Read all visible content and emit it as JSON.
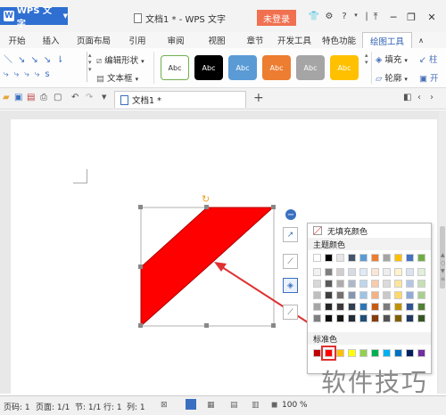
{
  "titlebar": {
    "app_name": "WPS 文字",
    "doc_title": "文档1 * - WPS 文字",
    "login_label": "未登录",
    "icons": [
      "shirt-icon",
      "gear-icon",
      "help-icon",
      "menu-icon",
      "upload-icon"
    ]
  },
  "tabs": [
    "开始",
    "插入",
    "页面布局",
    "引用",
    "审阅",
    "视图",
    "章节",
    "开发工具",
    "特色功能",
    "绘图工具"
  ],
  "active_tab": "绘图工具",
  "ribbon": {
    "edit_shape_label": "编辑形状",
    "textbox_label": "文本框",
    "style_cards": [
      {
        "label": "Abc",
        "bg": "#ffffff",
        "fg": "#333333",
        "border": "#70b050"
      },
      {
        "label": "Abc",
        "bg": "#000000",
        "fg": "#ffffff",
        "border": "#000000"
      },
      {
        "label": "Abc",
        "bg": "#5b9bd5",
        "fg": "#ffffff",
        "border": "#5b9bd5"
      },
      {
        "label": "Abc",
        "bg": "#ed7d31",
        "fg": "#ffffff",
        "border": "#ed7d31"
      },
      {
        "label": "Abc",
        "bg": "#a5a5a5",
        "fg": "#ffffff",
        "border": "#a5a5a5"
      },
      {
        "label": "Abc",
        "bg": "#ffc000",
        "fg": "#ffffff",
        "border": "#ffc000"
      }
    ],
    "fill_label": "填充",
    "outline_label": "轮廓"
  },
  "quickaccess": {
    "doc_tab_label": "文档1 *",
    "new_tab_label": "+"
  },
  "popup": {
    "no_fill_label": "无填充颜色",
    "theme_colors_label": "主题颜色",
    "standard_colors_label": "标准色",
    "theme_top_row": [
      "#ffffff",
      "#000000",
      "#e7e6e6",
      "#44546a",
      "#5b9bd5",
      "#ed7d31",
      "#a5a5a5",
      "#ffc000",
      "#4472c4",
      "#70ad47"
    ],
    "theme_shades": [
      [
        "#f2f2f2",
        "#7f7f7f",
        "#d0cece",
        "#d6dce4",
        "#deebf6",
        "#fbe5d5",
        "#ededed",
        "#fff2cc",
        "#dae3f3",
        "#e2efd9"
      ],
      [
        "#d8d8d8",
        "#595959",
        "#aeabab",
        "#adb9ca",
        "#bdd7ee",
        "#f7cbac",
        "#dbdbdb",
        "#fee599",
        "#b4c6e7",
        "#c5e0b3"
      ],
      [
        "#bfbfbf",
        "#3f3f3f",
        "#757070",
        "#8496b0",
        "#9dc3e6",
        "#f4b183",
        "#c9c9c9",
        "#ffd965",
        "#8eaadb",
        "#a8d08d"
      ],
      [
        "#a5a5a5",
        "#262626",
        "#3a3838",
        "#323f4f",
        "#2e75b5",
        "#c55a11",
        "#7b7b7b",
        "#bf9000",
        "#2f5496",
        "#538135"
      ],
      [
        "#7f7f7f",
        "#0c0c0c",
        "#171616",
        "#222a35",
        "#1e4e79",
        "#833c0b",
        "#525252",
        "#7f6000",
        "#1f3864",
        "#375623"
      ]
    ],
    "standard_colors": [
      "#c00000",
      "#ff0000",
      "#ffc000",
      "#ffff00",
      "#92d050",
      "#00b050",
      "#00b0f0",
      "#0070c0",
      "#002060",
      "#7030a0"
    ],
    "selected_standard": 1
  },
  "shape": {
    "fill": "#ff0000",
    "stroke": "#b00000"
  },
  "status": {
    "page_num": "页码: 1",
    "page": "页面: 1/1",
    "section": "节: 1/1",
    "row": "行: 1",
    "col": "列: 1",
    "zoom": "100 %"
  },
  "watermark": "软件技巧",
  "colors": {
    "accent": "#2e6fd1",
    "login": "#f07050",
    "arrow": "#e03030"
  }
}
